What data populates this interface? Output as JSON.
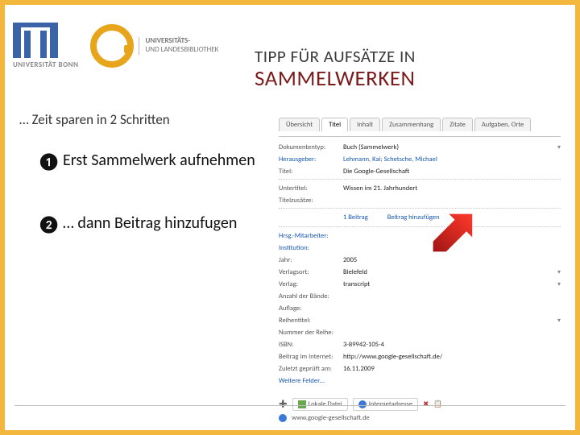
{
  "header": {
    "uni_logo_text": "UNIVERSITÄT BONN",
    "ulb_line1": "UNIVERSITÄTS-",
    "ulb_line2": "UND LANDESBIBLIOTHEK",
    "title_small": "TIPP FÜR AUFSÄTZE IN",
    "title_big": "SAMMELWERKEN"
  },
  "subhead": "… Zeit sparen in 2 Schritten",
  "steps": {
    "bullet1": "❶",
    "text1": "Erst Sammelwerk aufnehmen",
    "bullet2": "❷",
    "text2": "… dann Beitrag hinzufugen"
  },
  "app": {
    "tabs": [
      "Übersicht",
      "Titel",
      "Inhalt",
      "Zusammenhang",
      "Zitate",
      "Aufgaben, Orte"
    ],
    "active_tab_index": 1,
    "labels": {
      "doctype": "Dokumententyp:",
      "hrsg": "Herausgeber:",
      "titel": "Titel:",
      "utitel": "Untertitel:",
      "titelzus": "Titelzusätze:",
      "hrsgmit": "Hrsg.-Mitarbeiter:",
      "inst": "Institution:",
      "jahr": "Jahr:",
      "ort": "Verlagsort:",
      "verlag": "Verlag:",
      "baende": "Anzahl der Bände:",
      "auflage": "Auflage:",
      "reihe": "Reihentitel:",
      "nummer": "Nummer der Reihe:",
      "isbn": "ISBN:",
      "netbeitrag": "Beitrag im Internet:",
      "zuletzt": "Zuletzt geprüft am:",
      "weiter": "Weitere Felder…"
    },
    "values": {
      "doctype": "Buch (Sammelwerk)",
      "hrsg": "Lehmann, Kai; Schetsche, Michael",
      "titel": "Die Google-Gesellschaft",
      "utitel": "Wissen im 21. Jahrhundert",
      "beitraege_count": "1 Beitrag",
      "beitrag_add": "Beitrag hinzufügen",
      "jahr": "2005",
      "ort": "Bielefeld",
      "verlag": "transcript",
      "isbn": "3-89942-105-4",
      "netbeitrag": "http://www.google-gesellschaft.de/",
      "zuletzt": "16.11.2009"
    },
    "bottom": {
      "local": "Lokale Datei",
      "web": "Internetadresse",
      "addr": "www.google-gesellschaft.de"
    }
  }
}
